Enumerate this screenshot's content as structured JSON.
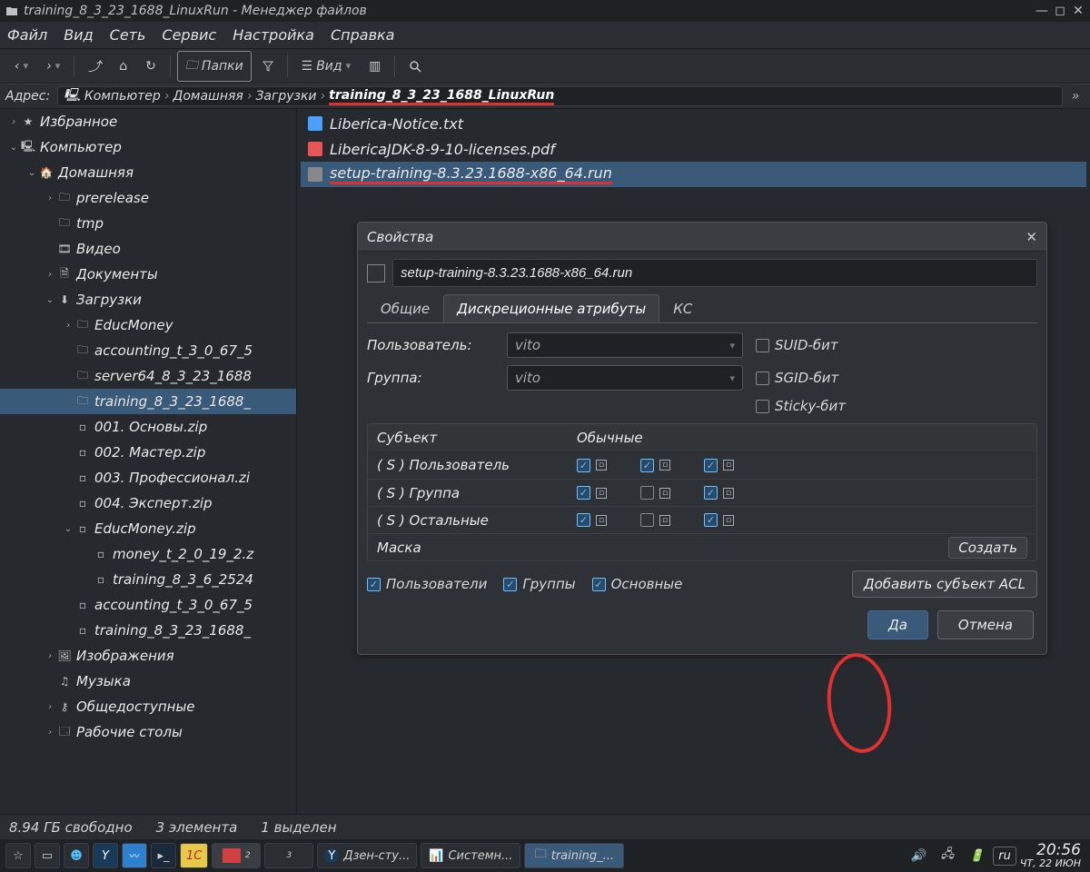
{
  "titlebar": {
    "title": "training_8_3_23_1688_LinuxRun - Менеджер файлов"
  },
  "menu": {
    "items": [
      "Файл",
      "Вид",
      "Сеть",
      "Сервис",
      "Настройка",
      "Справка"
    ]
  },
  "toolbar": {
    "folders": "Папки",
    "view": "Вид"
  },
  "address": {
    "label": "Адрес:",
    "segments": [
      "Компьютер",
      "Домашняя",
      "Загрузки"
    ],
    "current": "training_8_3_23_1688_LinuxRun"
  },
  "tree": [
    {
      "lvl": 0,
      "tg": "›",
      "ic": "★",
      "label": "Избранное"
    },
    {
      "lvl": 0,
      "tg": "⌄",
      "ic": "🖳",
      "label": "Компьютер"
    },
    {
      "lvl": 1,
      "tg": "⌄",
      "ic": "🏠",
      "label": "Домашняя"
    },
    {
      "lvl": 2,
      "tg": "›",
      "ic": "🗀",
      "label": "prerelease"
    },
    {
      "lvl": 2,
      "tg": "",
      "ic": "🗀",
      "label": "tmp"
    },
    {
      "lvl": 2,
      "tg": "",
      "ic": "🎞",
      "label": "Видео"
    },
    {
      "lvl": 2,
      "tg": "›",
      "ic": "🗎",
      "label": "Документы"
    },
    {
      "lvl": 2,
      "tg": "⌄",
      "ic": "⬇",
      "label": "Загрузки"
    },
    {
      "lvl": 3,
      "tg": "›",
      "ic": "🗀",
      "label": "EducMoney"
    },
    {
      "lvl": 3,
      "tg": "",
      "ic": "🗀",
      "label": "accounting_t_3_0_67_5"
    },
    {
      "lvl": 3,
      "tg": "",
      "ic": "🗀",
      "label": "server64_8_3_23_1688"
    },
    {
      "lvl": 3,
      "tg": "",
      "ic": "🗀",
      "label": "training_8_3_23_1688_",
      "sel": true
    },
    {
      "lvl": 3,
      "tg": "",
      "ic": "▫",
      "label": "001. Основы.zip"
    },
    {
      "lvl": 3,
      "tg": "",
      "ic": "▫",
      "label": "002. Мастер.zip"
    },
    {
      "lvl": 3,
      "tg": "",
      "ic": "▫",
      "label": "003. Профессионал.zi"
    },
    {
      "lvl": 3,
      "tg": "",
      "ic": "▫",
      "label": "004. Эксперт.zip"
    },
    {
      "lvl": 3,
      "tg": "⌄",
      "ic": "▫",
      "label": "EducMoney.zip"
    },
    {
      "lvl": 4,
      "tg": "",
      "ic": "▫",
      "label": "money_t_2_0_19_2.z"
    },
    {
      "lvl": 4,
      "tg": "",
      "ic": "▫",
      "label": "training_8_3_6_2524"
    },
    {
      "lvl": 3,
      "tg": "",
      "ic": "▫",
      "label": "accounting_t_3_0_67_5"
    },
    {
      "lvl": 3,
      "tg": "",
      "ic": "▫",
      "label": "training_8_3_23_1688_"
    },
    {
      "lvl": 2,
      "tg": "›",
      "ic": "🖼",
      "label": "Изображения"
    },
    {
      "lvl": 2,
      "tg": "",
      "ic": "♫",
      "label": "Музыка"
    },
    {
      "lvl": 2,
      "tg": "›",
      "ic": "⚷",
      "label": "Общедоступные"
    },
    {
      "lvl": 2,
      "tg": "›",
      "ic": "🗔",
      "label": "Рабочие столы"
    }
  ],
  "files": [
    {
      "icon": "#4aa0ff",
      "name": "Liberica-Notice.txt"
    },
    {
      "icon": "#e85555",
      "name": "LibericaJDK-8-9-10-licenses.pdf"
    },
    {
      "icon": "#888",
      "name": "setup-training-8.3.23.1688-x86_64.run",
      "sel": true,
      "ul": true
    }
  ],
  "dialog": {
    "title": "Свойства",
    "filename": "setup-training-8.3.23.1688-x86_64.run",
    "tabs": [
      "Общие",
      "Дискреционные атрибуты",
      "КС"
    ],
    "active_tab": 1,
    "user_label": "Пользователь:",
    "user_value": "vito",
    "group_label": "Группа:",
    "group_value": "vito",
    "suid": "SUID-бит",
    "sgid": "SGID-бит",
    "sticky": "Sticky-бит",
    "perm_header_subject": "Субъект",
    "perm_header_normal": "Обычные",
    "perm_rows": [
      {
        "label": "( S )  Пользователь",
        "r": true,
        "w": true,
        "x": true
      },
      {
        "label": "( S )  Группа",
        "r": true,
        "w": false,
        "x": true
      },
      {
        "label": "( S )  Остальные",
        "r": true,
        "w": false,
        "x": true
      }
    ],
    "mask_label": "Маска",
    "mask_btn": "Создать",
    "chk_users": "Пользователи",
    "chk_groups": "Группы",
    "chk_basic": "Основные",
    "acl_btn": "Добавить субъект ACL",
    "ok": "Да",
    "cancel": "Отмена"
  },
  "status": {
    "free": "8.94 ГБ свободно",
    "count": "3 элемента",
    "selected": "1 выделен"
  },
  "taskbar": {
    "apps": [
      {
        "label": "Дзен-сту..."
      },
      {
        "label": "Системн..."
      },
      {
        "label": "training_...",
        "active": true
      }
    ],
    "lang": "ru",
    "time": "20:56",
    "date": "ЧТ, 22 ИЮН"
  }
}
